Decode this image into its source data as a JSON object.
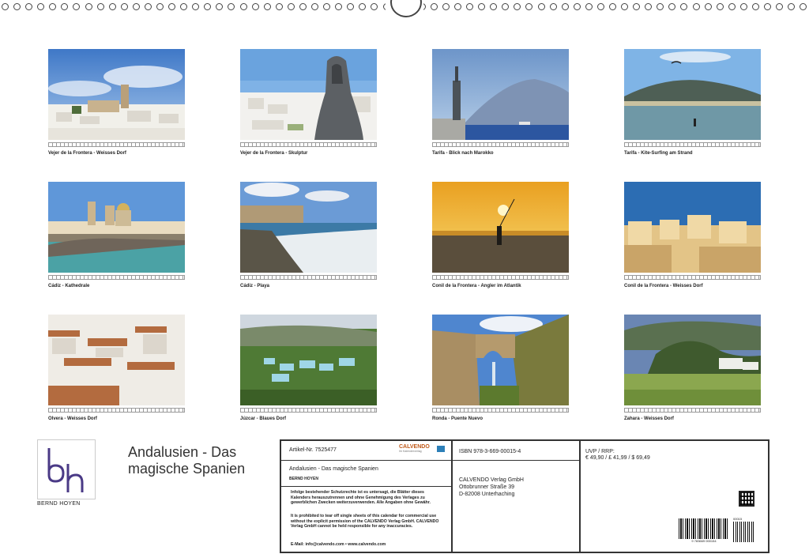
{
  "photos": [
    {
      "caption": "Vejer de la Frontera - Weisses Dorf"
    },
    {
      "caption": "Vejer de la Frontera - Skulptur"
    },
    {
      "caption": "Tarifa - Blick nach Marokko"
    },
    {
      "caption": "Tarifa - Kite-Surfing am Strand"
    },
    {
      "caption": "Cádiz - Kathedrale"
    },
    {
      "caption": "Cádiz - Playa"
    },
    {
      "caption": "Conil de la Frontera - Angler im Atlantik"
    },
    {
      "caption": "Conil de la Frontera - Weisses Dorf"
    },
    {
      "caption": "Olvera - Weisses Dorf"
    },
    {
      "caption": "Júzcar - Blaues Dorf"
    },
    {
      "caption": "Ronda - Puente Nuevo"
    },
    {
      "caption": "Zahara - Weisses Dorf"
    }
  ],
  "cover": {
    "author": "BERND HOYEN",
    "title": "Andalusien - Das magische Spanien"
  },
  "info": {
    "article": "Artikel-Nr. 7525477",
    "brand": "CALVENDO",
    "brand_sub": "Ihr Kalenderverlag",
    "title": "Andalusien - Das magische Spanien",
    "author": "BERND HOYEN",
    "legal_de": "Infolge bestehender Schutzrechte ist es untersagt, die Blätter dieses Kalenders herauszutrennen und ohne Genehmigung des Verlages zu gewerblichen Zwecken weiterzuverwenden. Alle Angaben ohne Gewähr.",
    "legal_en": "It is prohibited to tear off single sheets of this calendar for commercial use without the explicit permission of the CALVENDO Verlag GmbH. CALVENDO Verlag GmbH cannot be held responsible for any inaccuracies.",
    "email": "E-Mail: info@calvendo.com • www.calvendo.com",
    "isbn": "ISBN 978-3-669-00015-4",
    "publisher": [
      "CALVENDO Verlag GmbH",
      "Ottobrunner Straße 39",
      "D-82008 Unterhaching"
    ],
    "uvp_label": "UVP / RRP:",
    "uvp_value": "€ 49,90 / £ 41,99 / $ 69,49",
    "barcode_num": "9 783669 000154",
    "barcode_addon": "00015"
  }
}
